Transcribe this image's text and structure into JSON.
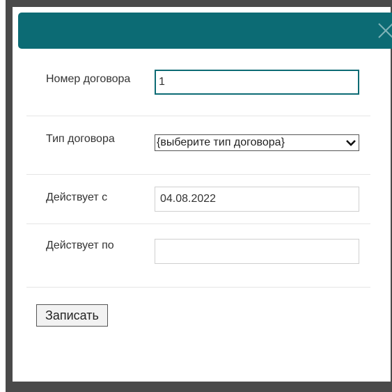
{
  "dialog": {
    "header_color": "#0c6b74",
    "close_icon": "close-icon"
  },
  "form": {
    "contract_number": {
      "label": "Номер договора",
      "value": "1"
    },
    "contract_type": {
      "label": "Тип договора",
      "selected": "{выберите тип договора}"
    },
    "valid_from": {
      "label": "Действует с",
      "value": "04.08.2022"
    },
    "valid_to": {
      "label": "Действует по",
      "value": ""
    },
    "save_label": "Записать"
  }
}
